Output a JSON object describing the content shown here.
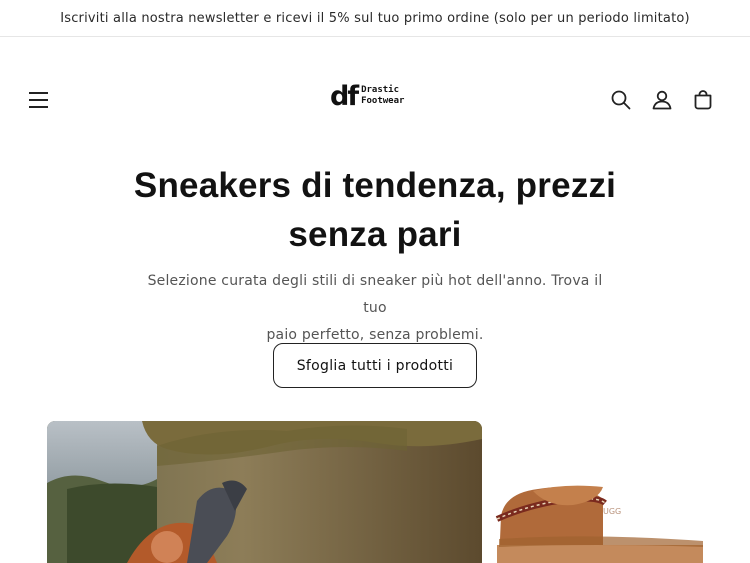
{
  "announcement": {
    "text": "Iscriviti alla nostra newsletter e ricevi il 5% sul tuo primo ordine (solo per un periodo limitato)"
  },
  "header": {
    "logo": {
      "mark": "df",
      "line1": "Drastic",
      "line2": "Footwear"
    },
    "icons": [
      "menu-icon",
      "search-icon",
      "account-icon",
      "cart-icon"
    ]
  },
  "hero": {
    "title_line1": "Sneakers di tendenza, prezzi",
    "title_line2": "senza pari",
    "subtitle_line1": "Selezione curata degli stili di sneaker più hot dell'anno. Trova il tuo",
    "subtitle_line2": "paio perfetto, senza problemi.",
    "cta_label": "Sfoglia tutti i prodotti"
  },
  "colors": {
    "text": "#121212",
    "muted": "#555555",
    "border": "#e6e6e6",
    "slipper": "#b36a36"
  }
}
